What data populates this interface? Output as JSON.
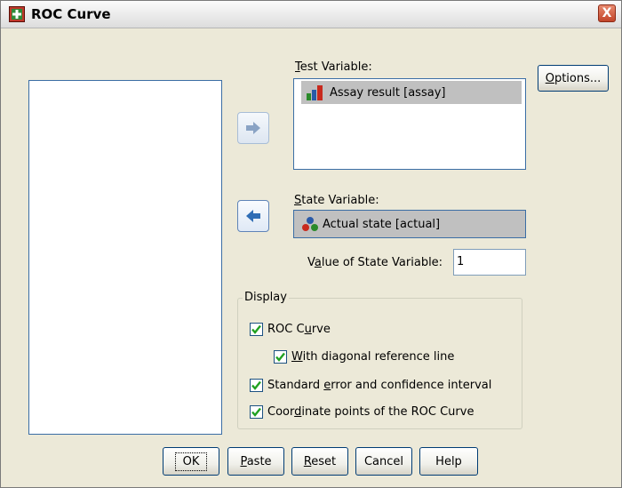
{
  "window": {
    "title": "ROC Curve",
    "close_label": "X"
  },
  "source_list": {
    "items": []
  },
  "test_variable": {
    "label_u": "T",
    "label_rest": "est Variable:",
    "item": "Assay result [assay]",
    "item_icon": "scale-variable-icon"
  },
  "state_variable": {
    "label_u": "S",
    "label_rest": "tate Variable:",
    "item": "Actual state [actual]",
    "item_icon": "nominal-variable-icon"
  },
  "value_of_state": {
    "label_pre": "V",
    "label_u": "a",
    "label_rest": "lue of State Variable:",
    "value": "1"
  },
  "options_button": {
    "label_u": "O",
    "label_rest": "ptions..."
  },
  "display": {
    "legend": "Display",
    "roc_curve": {
      "label_pre": "ROC C",
      "label_u": "u",
      "label_rest": "rve",
      "checked": true
    },
    "diagonal": {
      "label_u": "W",
      "label_rest": "ith diagonal reference line",
      "checked": true
    },
    "std_error": {
      "label_pre": "Standard ",
      "label_u": "e",
      "label_rest": "rror and confidence interval",
      "checked": true
    },
    "coordinate": {
      "label_pre": "Coor",
      "label_u": "d",
      "label_rest": "inate points of the ROC Curve",
      "checked": true
    }
  },
  "buttons": {
    "ok": "OK",
    "paste_u": "P",
    "paste_rest": "aste",
    "reset_u": "R",
    "reset_rest": "eset",
    "cancel": "Cancel",
    "help": "Help"
  },
  "colors": {
    "dialog_bg": "#ece9d8",
    "list_border": "#3b6ea5",
    "selection_bg": "#c0c0c0",
    "arrow_blue": "#2f6db5"
  }
}
